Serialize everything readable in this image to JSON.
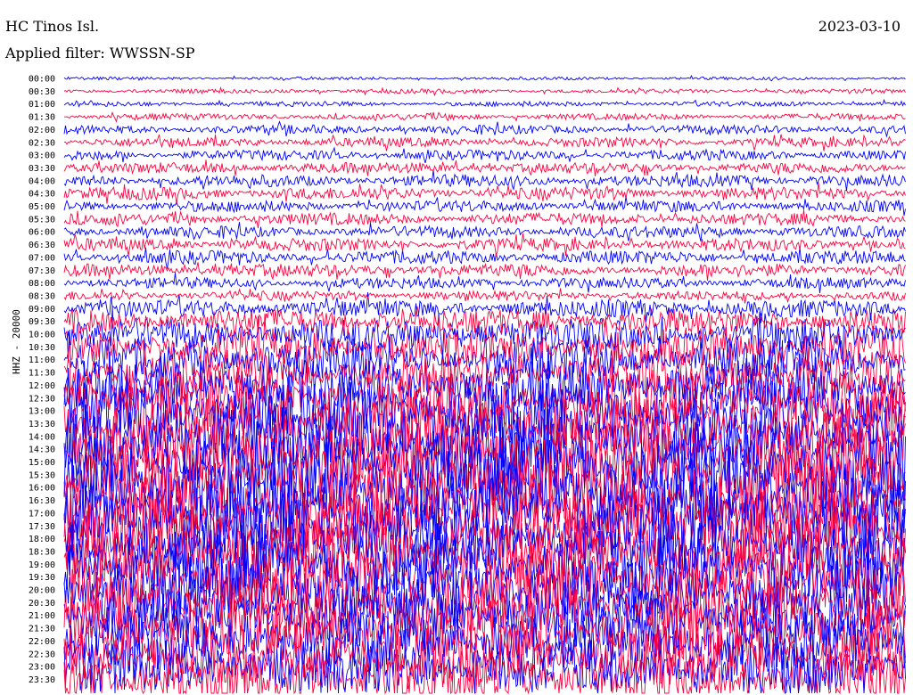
{
  "header": {
    "station": "HC Tinos Isl.",
    "date": "2023-03-10",
    "filter": "Applied filter: WWSSN-SP"
  },
  "channel": "HHZ - 20000",
  "chart_data": {
    "type": "helicorder",
    "row_labels": [
      "00:00",
      "00:30",
      "01:00",
      "01:30",
      "02:00",
      "02:30",
      "03:00",
      "03:30",
      "04:00",
      "04:30",
      "05:00",
      "05:30",
      "06:00",
      "06:30",
      "07:00",
      "07:30",
      "08:00",
      "08:30",
      "09:00",
      "09:30",
      "10:00",
      "10:30",
      "11:00",
      "11:30",
      "12:00",
      "12:30",
      "13:00",
      "13:30",
      "14:00",
      "14:30",
      "15:00",
      "15:30",
      "16:00",
      "16:30",
      "17:00",
      "17:30",
      "18:00",
      "18:30",
      "19:00",
      "19:30",
      "20:00",
      "20:30",
      "21:00",
      "21:30",
      "22:00",
      "22:30",
      "23:00",
      "23:30"
    ],
    "row_colors": [
      "#0000ff",
      "#ff0040"
    ],
    "relative_amplitude": [
      0.1,
      0.14,
      0.16,
      0.2,
      0.28,
      0.3,
      0.32,
      0.34,
      0.38,
      0.4,
      0.36,
      0.38,
      0.36,
      0.4,
      0.42,
      0.4,
      0.34,
      0.3,
      0.55,
      0.8,
      1.0,
      1.2,
      1.3,
      1.4,
      1.6,
      1.8,
      2.0,
      2.1,
      2.2,
      2.3,
      2.4,
      2.5,
      2.5,
      2.4,
      2.4,
      2.3,
      2.3,
      2.2,
      2.2,
      2.2,
      2.2,
      2.1,
      2.0,
      2.0,
      1.9,
      1.9,
      1.8,
      1.8
    ]
  }
}
